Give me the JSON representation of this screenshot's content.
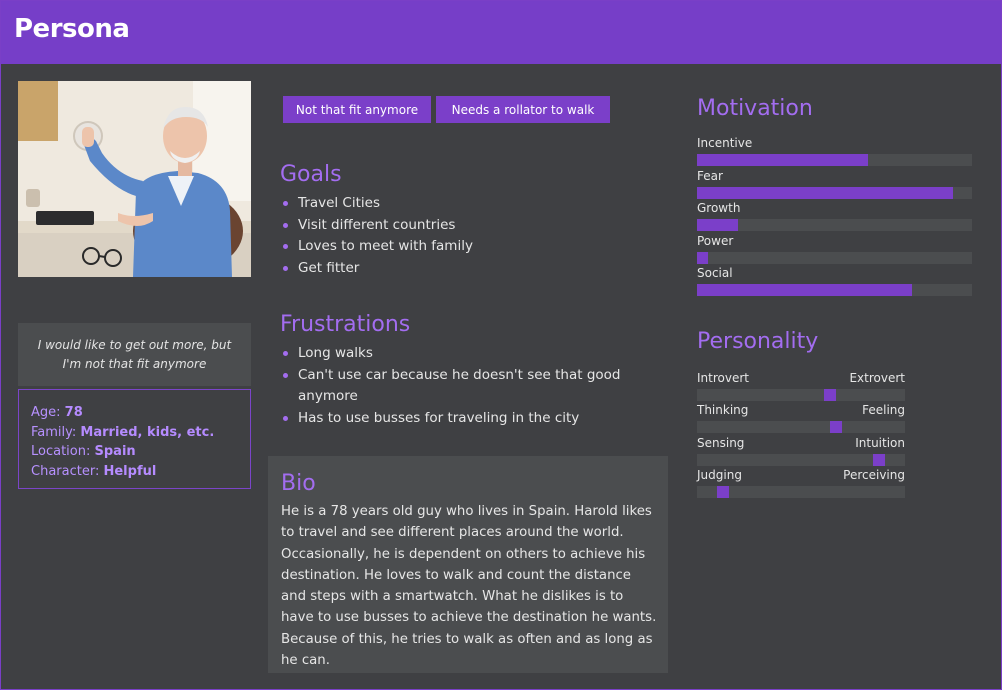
{
  "header": {
    "title": "Persona"
  },
  "tags": [
    "Not that fit anymore",
    "Needs a rollator to walk"
  ],
  "quote": "I would like to get out more, but I'm not that fit anymore",
  "facts": [
    {
      "label": "Age:",
      "value": "78"
    },
    {
      "label": "Family:",
      "value": "Married, kids, etc."
    },
    {
      "label": "Location:",
      "value": "Spain"
    },
    {
      "label": "Character:",
      "value": "Helpful"
    }
  ],
  "goals": {
    "title": "Goals",
    "items": [
      "Travel Cities",
      "Visit different countries",
      "Loves to meet with family",
      "Get fitter"
    ]
  },
  "frustrations": {
    "title": "Frustrations",
    "items": [
      "Long walks",
      "Can't use car because he doesn't see that good anymore",
      "Has to use busses for traveling in the city"
    ]
  },
  "bio": {
    "title": "Bio",
    "text": "He is a 78 years old guy who lives in Spain. Harold likes to travel and see different places around the world. Occasionally, he is dependent on others to achieve his destination. He loves to walk and count the distance and steps with a smartwatch. What he dislikes is to have to use busses to achieve the destination he wants. Because of this, he tries to walk as often and as long as he can."
  },
  "motivation": {
    "title": "Motivation",
    "items": [
      {
        "label": "Incentive",
        "level": 0.62
      },
      {
        "label": "Fear",
        "level": 0.93
      },
      {
        "label": "Growth",
        "level": 0.15
      },
      {
        "label": "Power",
        "level": 0.04
      },
      {
        "label": "Social",
        "level": 0.78
      }
    ]
  },
  "personality": {
    "title": "Personality",
    "items": [
      {
        "left": "Introvert",
        "right": "Extrovert",
        "level": 0.65
      },
      {
        "left": "Thinking",
        "right": "Feeling",
        "level": 0.68
      },
      {
        "left": "Sensing",
        "right": "Intuition",
        "level": 0.9
      },
      {
        "left": "Judging",
        "right": "Perceiving",
        "level": 0.1
      }
    ]
  },
  "colors": {
    "accent": "#763ec8",
    "background": "#3f4043",
    "panel": "#4b4d4f",
    "heading": "#a36df0"
  }
}
